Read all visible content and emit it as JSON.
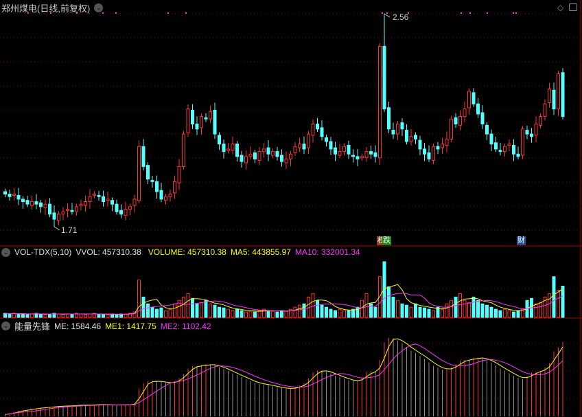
{
  "header": {
    "title": "郑州煤电(日线,前复权)",
    "dropdown_icon": "chevron-down-icon",
    "diamond_icon": "diamond-icon",
    "panel_icon": "panel-toggle-icon"
  },
  "price_pane": {
    "high_label": "2.56",
    "low_label": "1.71",
    "event_tags": [
      {
        "text": "权",
        "color": "#8b4513"
      },
      {
        "text": "跌",
        "color": "#1a8a1a"
      },
      {
        "text": "财",
        "color": "#1f4f8f"
      }
    ]
  },
  "volume_pane": {
    "name": "VOL-TDX(5,10)",
    "vvol": "VVOL: 457310.38",
    "volume": "VOLUME: 457310.38",
    "ma5": "MA5: 443855.97",
    "ma10": "MA10: 332001.34"
  },
  "me_pane": {
    "name": "能量先锋",
    "me": "ME: 1584.46",
    "me1": "ME1: 1417.75",
    "me2": "ME2: 1102.42"
  },
  "colors": {
    "up": "#ff3232",
    "down": "#54ffff",
    "grid": "#8b0000",
    "yellow": "#ffff00",
    "magenta": "#ff32ff",
    "white": "#e0e0e0"
  },
  "chart_data": {
    "type": "candlestick",
    "ylim": [
      1.71,
      2.56
    ],
    "closes": [
      1.84,
      1.83,
      1.84,
      1.82,
      1.81,
      1.8,
      1.81,
      1.8,
      1.79,
      1.8,
      1.76,
      1.74,
      1.76,
      1.77,
      1.78,
      1.77,
      1.79,
      1.8,
      1.81,
      1.83,
      1.84,
      1.83,
      1.81,
      1.82,
      1.8,
      1.77,
      1.76,
      1.78,
      1.79,
      1.82,
      2.03,
      1.95,
      1.9,
      1.89,
      1.85,
      1.82,
      1.83,
      1.84,
      1.89,
      1.95,
      2.08,
      2.18,
      2.12,
      2.1,
      2.15,
      2.14,
      2.17,
      2.08,
      2.04,
      2.01,
      2.02,
      2.04,
      1.99,
      1.97,
      1.99,
      2.0,
      1.98,
      2.01,
      2.02,
      2.0,
      2.01,
      1.99,
      1.97,
      1.98,
      2.0,
      2.03,
      2.04,
      2.02,
      2.08,
      2.12,
      2.1,
      2.07,
      2.05,
      2.02,
      2.0,
      2.01,
      2.03,
      2.0,
      1.99,
      1.98,
      1.99,
      2.01,
      2.0,
      1.99,
      2.43,
      2.18,
      2.1,
      2.08,
      2.12,
      2.1,
      2.05,
      2.07,
      2.06,
      2.02,
      2.0,
      1.98,
      2.03,
      2.02,
      2.04,
      2.06,
      2.14,
      2.12,
      2.15,
      2.18,
      2.25,
      2.2,
      2.16,
      2.12,
      2.08,
      2.04,
      2.02,
      2.01,
      2.03,
      2.04,
      2.0,
      1.99,
      2.1,
      2.08,
      2.07,
      2.12,
      2.15,
      2.2,
      2.26,
      2.18,
      2.32,
      2.15
    ],
    "volumes_10k": [
      6,
      5,
      6,
      5,
      5,
      4,
      5,
      6,
      5,
      4,
      5,
      6,
      5,
      4,
      5,
      5,
      6,
      5,
      4,
      5,
      6,
      5,
      4,
      4,
      5,
      4,
      5,
      5,
      6,
      8,
      55,
      30,
      20,
      15,
      12,
      14,
      10,
      12,
      20,
      25,
      30,
      35,
      28,
      20,
      22,
      25,
      20,
      18,
      15,
      14,
      12,
      10,
      12,
      10,
      8,
      9,
      8,
      10,
      12,
      10,
      9,
      8,
      10,
      9,
      12,
      15,
      18,
      20,
      30,
      35,
      25,
      18,
      15,
      12,
      10,
      12,
      10,
      10,
      12,
      15,
      25,
      35,
      20,
      15,
      60,
      82,
      45,
      30,
      25,
      20,
      18,
      15,
      20,
      15,
      14,
      12,
      10,
      15,
      12,
      20,
      25,
      30,
      35,
      25,
      22,
      30,
      25,
      20,
      18,
      15,
      12,
      10,
      12,
      10,
      8,
      10,
      12,
      25,
      28,
      20,
      22,
      30,
      35,
      60,
      40,
      46
    ]
  }
}
